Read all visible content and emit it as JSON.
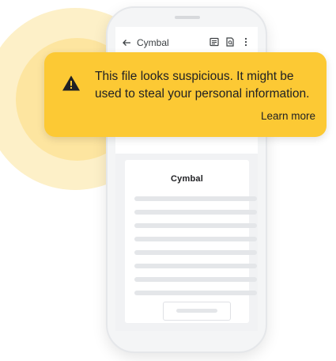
{
  "app_bar": {
    "title": "Cymbal",
    "back_icon": "arrow-left-icon",
    "actions": [
      "comment-icon",
      "document-search-icon",
      "more-vert-icon"
    ]
  },
  "warning": {
    "icon": "warning-triangle-icon",
    "message": "This file looks suspicious. It might be used to steal your personal information.",
    "link_label": "Learn more"
  },
  "document": {
    "logo_text": "Cymbal"
  },
  "colors": {
    "banner": "#fcc934",
    "halo_outer": "#fdf0c8",
    "halo_inner": "#fde5a0"
  }
}
